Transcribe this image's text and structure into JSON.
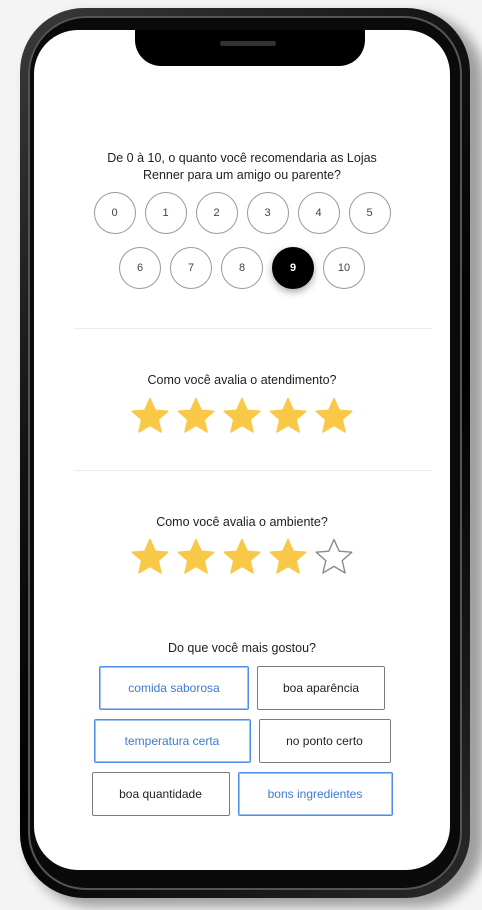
{
  "nps": {
    "question_line1": "De 0 à 10, o quanto você recomendaria as Lojas",
    "question_line2": "Renner para um amigo ou parente?",
    "row1": [
      "0",
      "1",
      "2",
      "3",
      "4",
      "5"
    ],
    "row2": [
      "6",
      "7",
      "8",
      "9",
      "10"
    ],
    "selected": 9
  },
  "service": {
    "question": "Como você avalia o atendimento?",
    "rating": 5,
    "max": 5
  },
  "ambience": {
    "question": "Como você avalia o ambiente?",
    "rating": 4,
    "max": 5
  },
  "likes": {
    "question": "Do que você mais gostou?",
    "chips": [
      {
        "label": "comida saborosa",
        "selected": true
      },
      {
        "label": "boa aparência",
        "selected": false
      },
      {
        "label": "temperatura certa",
        "selected": true
      },
      {
        "label": "no ponto certo",
        "selected": false
      },
      {
        "label": "boa quantidade",
        "selected": false
      },
      {
        "label": "bons ingredientes",
        "selected": true
      }
    ]
  },
  "colors": {
    "star_filled": "#F9C846",
    "star_empty_stroke": "#8a8a8a",
    "chip_selected": "#4D8EE6",
    "nps_selected": "#000000"
  }
}
